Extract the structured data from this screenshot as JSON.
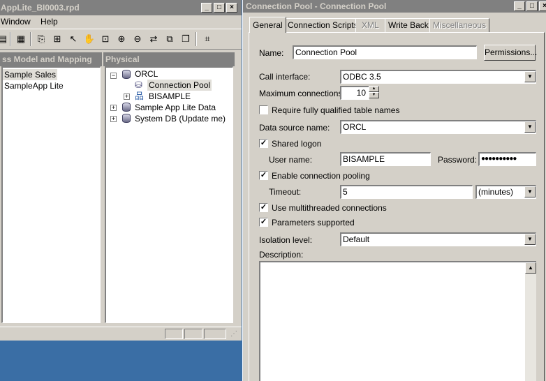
{
  "back_window": {
    "title": "AppLite_BI0003.rpd",
    "menu": [
      "Window",
      "Help"
    ],
    "left_pane": {
      "header": "ss Model and Mapping",
      "items": [
        "Sample Sales",
        "SampleApp Lite"
      ]
    },
    "right_pane": {
      "header": "Physical",
      "tree": {
        "orcl": "ORCL",
        "connection_pool": "Connection Pool",
        "bisample": "BISAMPLE",
        "sample_app_lite_data": "Sample App Lite Data",
        "system_db": "System DB (Update me)"
      }
    }
  },
  "dialog": {
    "title": "Connection Pool - Connection Pool",
    "tabs": [
      "General",
      "Connection Scripts",
      "XML",
      "Write Back",
      "Miscellaneous"
    ],
    "active_tab": "General",
    "name_label": "Name:",
    "name_value": "Connection Pool",
    "permissions_label": "Permissions...",
    "call_interface_label": "Call interface:",
    "call_interface_value": "ODBC 3.5",
    "max_connections_label": "Maximum connections:",
    "max_connections_value": "10",
    "require_fq_label": "Require fully qualified table names",
    "require_fq_checked": false,
    "data_source_label": "Data source name:",
    "data_source_value": "ORCL",
    "shared_logon_label": "Shared logon",
    "shared_logon_checked": true,
    "user_name_label": "User name:",
    "user_name_value": "BISAMPLE",
    "password_label": "Password:",
    "password_value": "●●●●●●●●●●",
    "enable_pooling_label": "Enable connection pooling",
    "enable_pooling_checked": true,
    "timeout_label": "Timeout:",
    "timeout_value": "5",
    "timeout_unit": "(minutes)",
    "multithreaded_label": "Use multithreaded connections",
    "multithreaded_checked": true,
    "params_supported_label": "Parameters supported",
    "params_supported_checked": true,
    "isolation_label": "Isolation level:",
    "isolation_value": "Default",
    "description_label": "Description:",
    "description_value": ""
  }
}
